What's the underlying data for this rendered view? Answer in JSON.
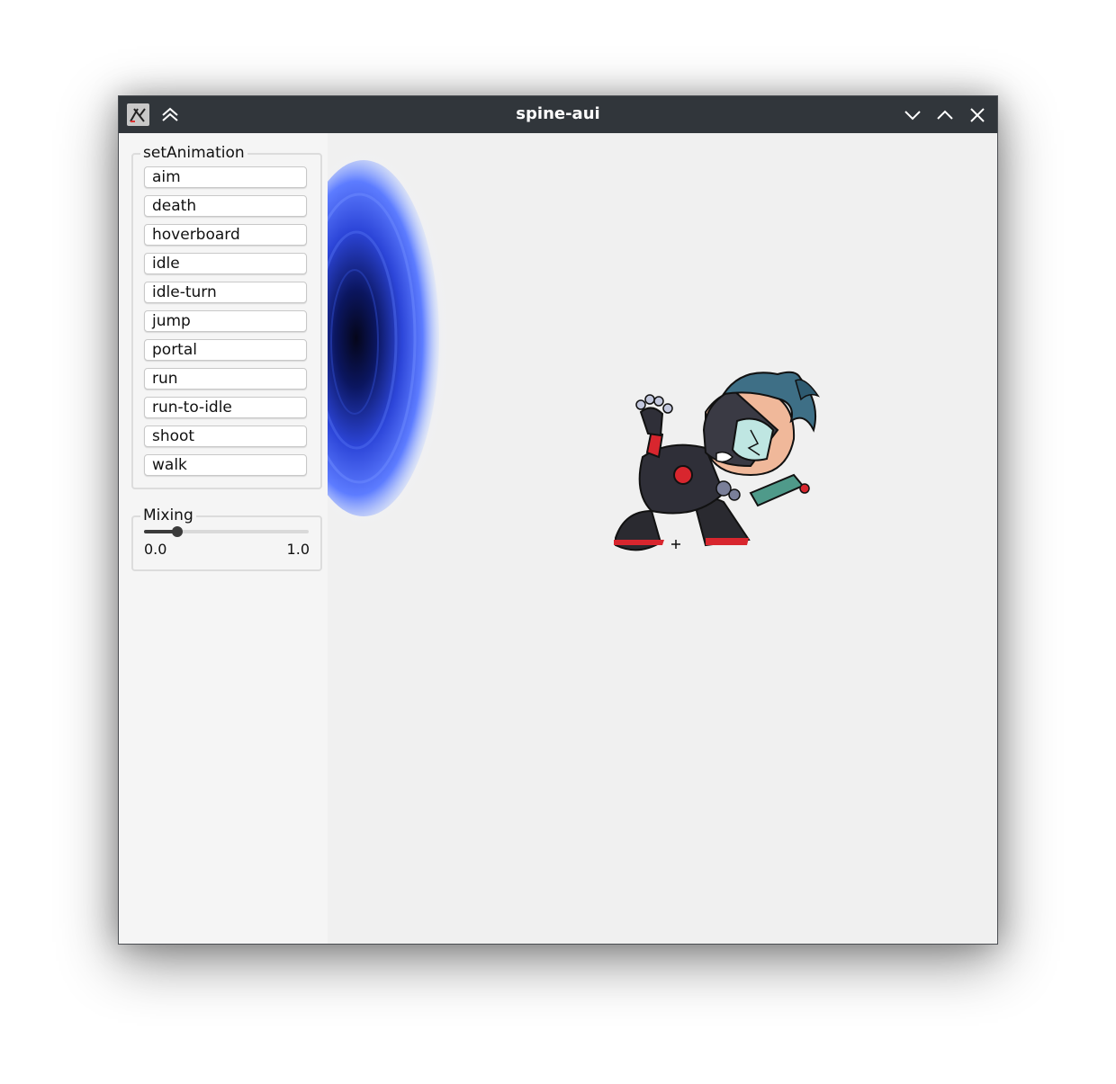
{
  "window": {
    "title": "spine-aui"
  },
  "sidebar": {
    "animation_group": {
      "legend": "setAnimation",
      "buttons": [
        "aim",
        "death",
        "hoverboard",
        "idle",
        "idle-turn",
        "jump",
        "portal",
        "run",
        "run-to-idle",
        "shoot",
        "walk"
      ]
    },
    "mixing_group": {
      "legend": "Mixing",
      "min_label": "0.0",
      "max_label": "1.0",
      "value": 0.2
    }
  },
  "icons": {
    "app": "app-icon",
    "keep-above": "double-chevron-up-icon",
    "minimize": "chevron-down-icon",
    "maximize": "chevron-up-icon",
    "close": "close-icon"
  },
  "colors": {
    "titlebar": "#31363b",
    "portal": "#3a5cf0",
    "character_hair": "#3e6f86",
    "character_accent": "#d8262e"
  }
}
